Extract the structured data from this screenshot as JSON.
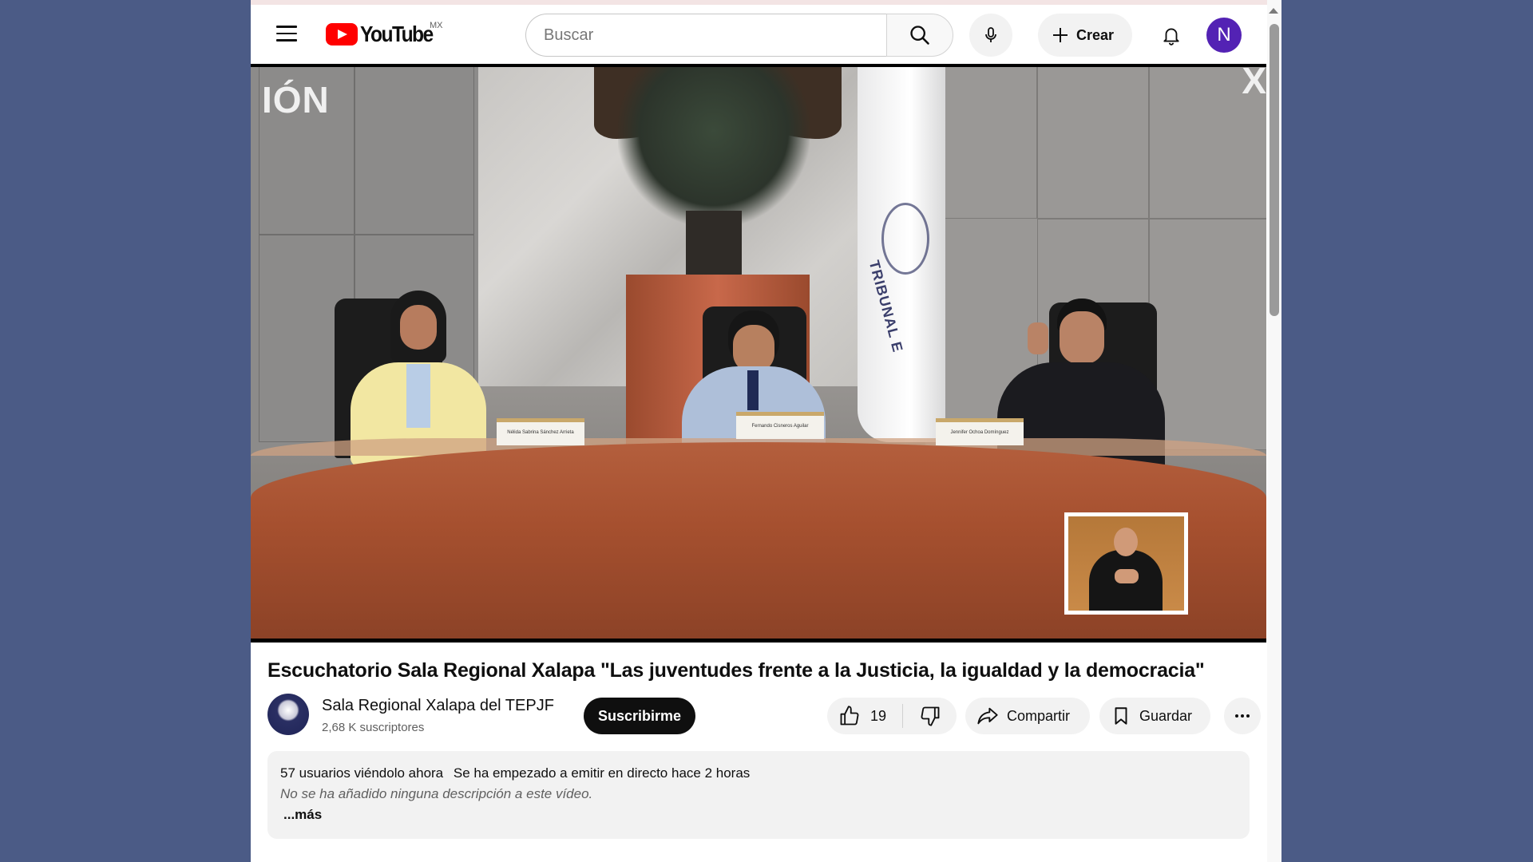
{
  "masthead": {
    "logo_text": "YouTube",
    "country_code": "MX",
    "search_placeholder": "Buscar",
    "create_label": "Crear",
    "avatar_letter": "N"
  },
  "video": {
    "overlay_left": "IÓN",
    "overlay_right": "X",
    "flag_text": "TRIBUNAL E",
    "nameplates": [
      "Nélida Sabrina Sánchez Arrieta",
      "Fernando Cisneros Aguilar",
      "Jennifer Ochoa Domínguez"
    ]
  },
  "info": {
    "title": "Escuchatorio Sala Regional Xalapa \"Las juventudes frente a la Justicia, la igualdad y la democracia\"",
    "channel_name": "Sala Regional Xalapa del TEPJF",
    "subscribers": "2,68 K suscriptores",
    "subscribe_label": "Suscribirme",
    "like_count": "19",
    "share_label": "Compartir",
    "save_label": "Guardar"
  },
  "description": {
    "viewers": "57 usuarios viéndolo ahora",
    "started": "Se ha empezado a emitir en directo hace 2 horas",
    "body": "No se ha añadido ninguna descripción a este vídeo.",
    "more": "...más"
  },
  "colors": {
    "page_background": "#4b5b86",
    "brand_red": "#ff0000",
    "avatar": "#5322b4"
  }
}
